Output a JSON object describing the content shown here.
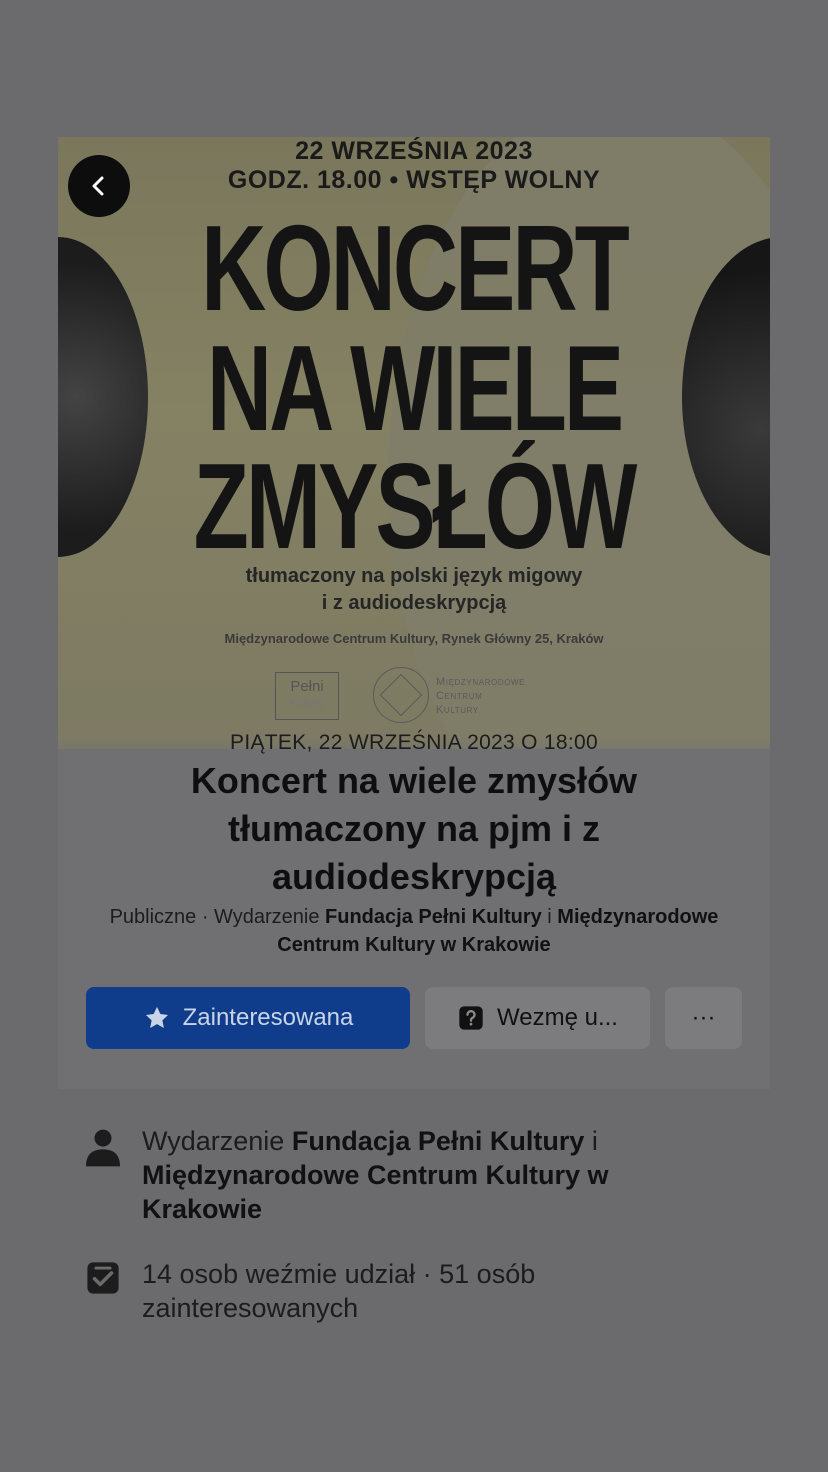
{
  "poster": {
    "date": "22 WRZEŚNIA 2023",
    "time_line": "GODZ. 18.00 • WSTĘP WOLNY",
    "big1": "KONCERT",
    "big2": "NA WIELE",
    "big3": "ZMYSŁÓW",
    "sub1": "tłumaczony na polski język migowy",
    "sub2": "i z audiodeskrypcją",
    "address": "Międzynarodowe Centrum Kultury, Rynek Główny 25, Kraków",
    "logo1_line1": "Pełni",
    "logo1_line2": "Kultury",
    "logo2_text": [
      "Międzynarodowe",
      "Centrum",
      "Kultury"
    ]
  },
  "event": {
    "date_line": "PIĄTEK, 22 WRZEŚNIA 2023 O 18:00",
    "title": "Koncert na wiele zmysłów tłumaczony na pjm i z audiodeskrypcją",
    "meta_prefix": "Publiczne · Wydarzenie ",
    "organizer1": "Fundacja Pełni Kultury",
    "joiner": " i ",
    "organizer2": "Międzynarodowe Centrum Kultury w Krakowie"
  },
  "actions": {
    "interested_label": "Zainteresowana",
    "going_label": "Wezmę u...",
    "more_label": "···"
  },
  "details": {
    "host_prefix": "Wydarzenie ",
    "host1": "Fundacja Pełni Kultury",
    "host_joiner": " i ",
    "host2": "Międzynarodowe Centrum Kultury w Krakowie",
    "attendance": "14 osob weźmie udział · 51 osób zainteresowanych"
  },
  "colors": {
    "primary_button": "#0f3d8c",
    "overlay_background": "#6b6b6d"
  },
  "icons": {
    "back": "chevron-left-icon",
    "interested": "star-icon",
    "going": "question-box-icon",
    "host": "person-icon",
    "attendance": "checklist-icon"
  }
}
